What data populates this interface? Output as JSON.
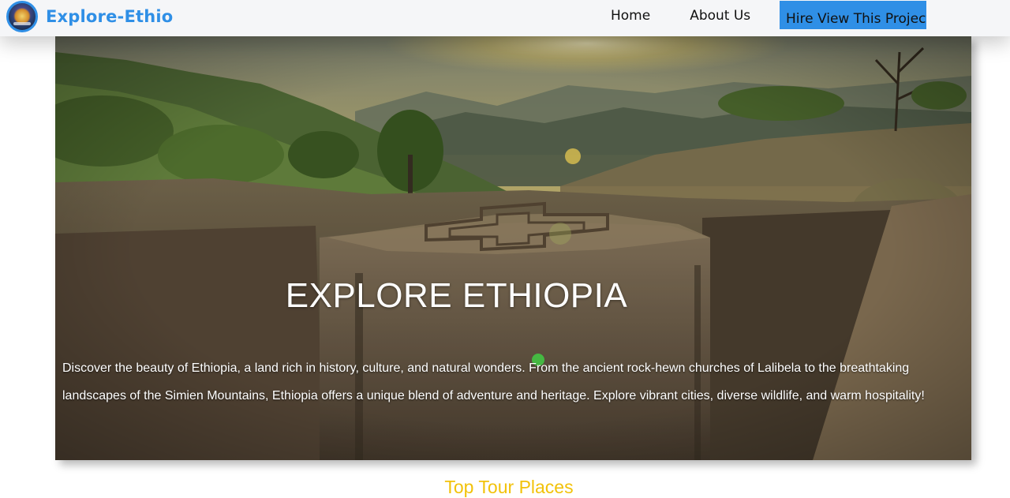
{
  "header": {
    "brand": "Explore-Ethio",
    "nav": [
      "Home",
      "About Us"
    ],
    "cta": "Hire View This Project"
  },
  "hero": {
    "title": "EXPLORE ETHIOPIA",
    "description": "Discover the beauty of Ethiopia, a land rich in history, culture, and natural wonders. From the ancient rock-hewn churches of Lalibela to the breathtaking landscapes of the Simien Mountains, Ethiopia offers a unique blend of adventure and heritage. Explore vibrant cities, diverse wildlife, and warm hospitality!"
  },
  "sections": {
    "top_places_heading": "Top Tour Places"
  },
  "colors": {
    "brand_blue": "#2f8fe6",
    "heading_yellow": "#f2c20a"
  }
}
